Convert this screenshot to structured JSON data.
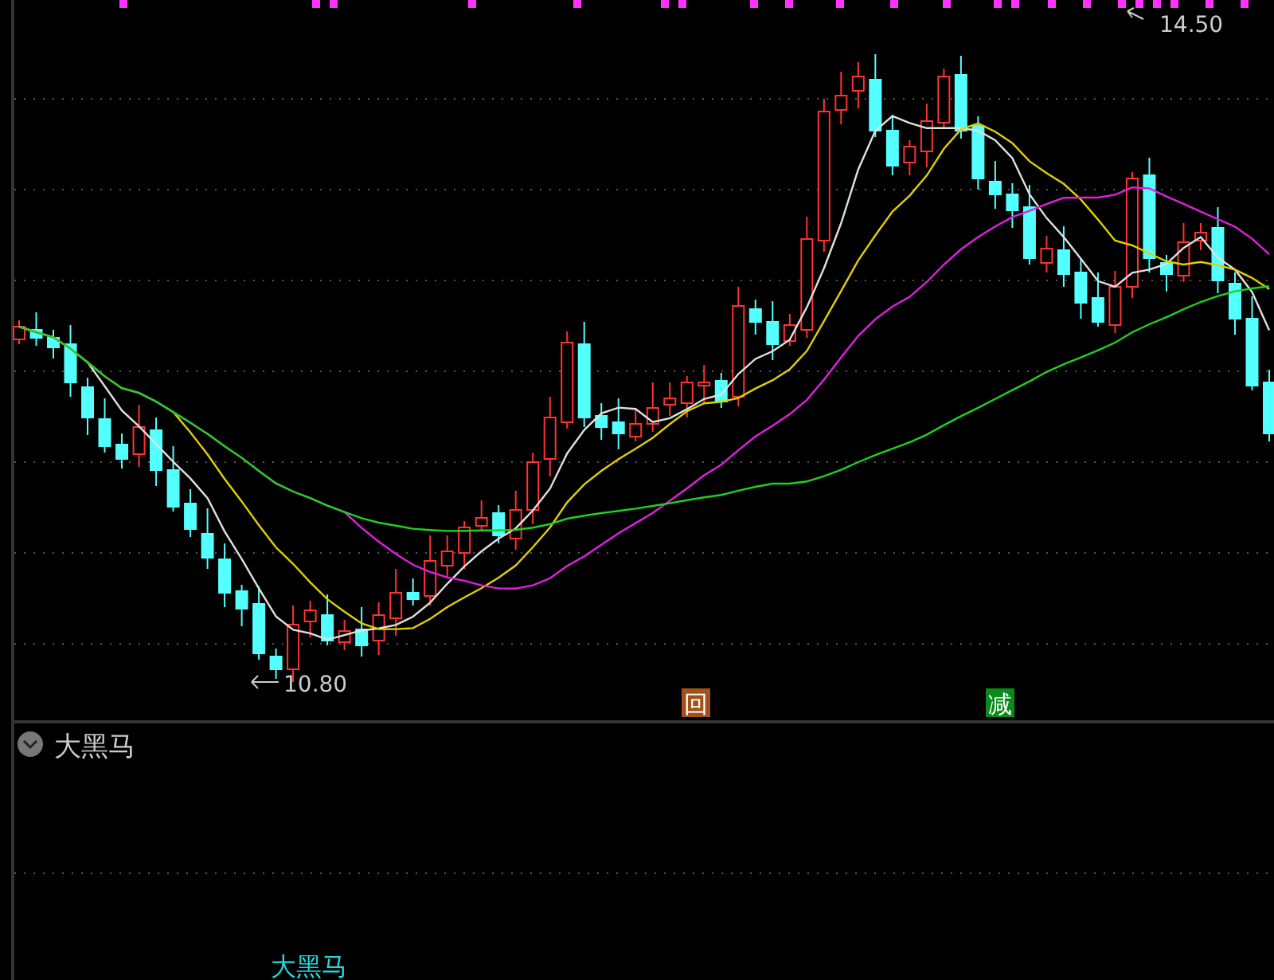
{
  "main_chart": {
    "high_label": "14.50",
    "low_label": "10.80",
    "signals": [
      {
        "kind": "return",
        "text": "回"
      },
      {
        "kind": "reduce",
        "text": "减"
      }
    ]
  },
  "indicator_panel": {
    "title": "大黑马",
    "plot_label": "大黑马"
  }
}
